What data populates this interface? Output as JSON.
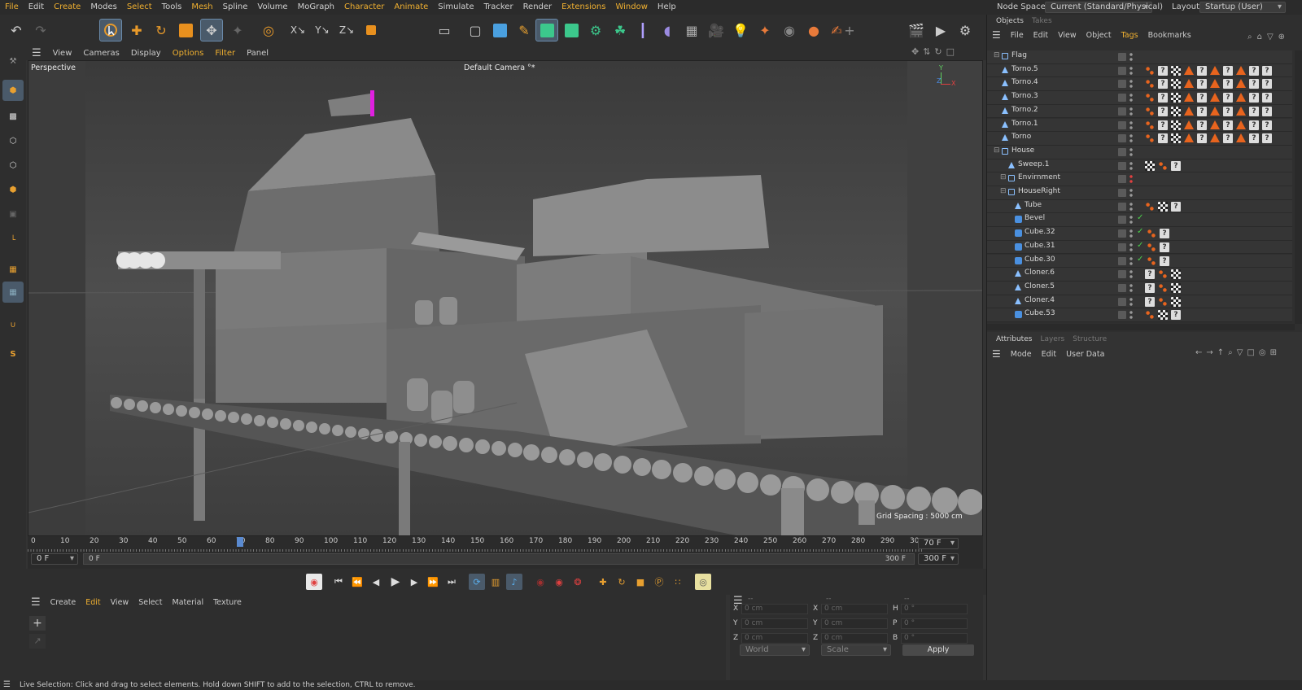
{
  "menubar": {
    "items": [
      "File",
      "Edit",
      "Create",
      "Modes",
      "Select",
      "Tools",
      "Mesh",
      "Spline",
      "Volume",
      "MoGraph",
      "Character",
      "Animate",
      "Simulate",
      "Tracker",
      "Render",
      "Extensions",
      "Window",
      "Help"
    ],
    "highlighted": [
      "Create",
      "Select",
      "Mesh",
      "Character",
      "Animate",
      "Extensions",
      "Window",
      "File"
    ],
    "node_space_label": "Node Space:",
    "node_space_value": "Current (Standard/Physical)",
    "layout_label": "Layout:",
    "layout_value": "Startup (User)"
  },
  "viewport": {
    "menu": [
      "View",
      "Cameras",
      "Display",
      "Options",
      "Filter",
      "Panel"
    ],
    "menu_highlight": [
      "Options",
      "Filter"
    ],
    "perspective_label": "Perspective",
    "camera_label": "Default Camera",
    "camera_mark": "°*",
    "grid_spacing": "Grid Spacing : 5000 cm",
    "axis_y": "Y",
    "axis_z": "Z",
    "axis_x": "X"
  },
  "timeline": {
    "ticks": [
      "0",
      "10",
      "20",
      "30",
      "40",
      "50",
      "60",
      "70",
      "80",
      "90",
      "100",
      "110",
      "120",
      "130",
      "140",
      "150",
      "160",
      "170",
      "180",
      "190",
      "200",
      "210",
      "220",
      "230",
      "240",
      "250",
      "260",
      "270",
      "280",
      "290",
      "30"
    ],
    "current_frame": 70,
    "current_frame_field": "70 F",
    "start_field": "0 F",
    "range_start": "0 F",
    "range_end": "300 F",
    "end_field": "300 F"
  },
  "material_manager": {
    "menu": [
      "Create",
      "Edit",
      "View",
      "Select",
      "Material",
      "Texture"
    ],
    "menu_highlight": [
      "Edit"
    ]
  },
  "coordinates": {
    "headers": [
      "--",
      "--",
      "--"
    ],
    "rows": [
      {
        "a_label": "X",
        "a_value": "0 cm",
        "b_label": "X",
        "b_value": "0 cm",
        "c_label": "H",
        "c_value": "0 °"
      },
      {
        "a_label": "Y",
        "a_value": "0 cm",
        "b_label": "Y",
        "b_value": "0 cm",
        "c_label": "P",
        "c_value": "0 °"
      },
      {
        "a_label": "Z",
        "a_value": "0 cm",
        "b_label": "Z",
        "b_value": "0 cm",
        "c_label": "B",
        "c_value": "0 °"
      }
    ],
    "space_select": "World",
    "mode_select": "Scale",
    "apply_label": "Apply"
  },
  "status_text": "Live Selection: Click and drag to select elements. Hold down SHIFT to add to the selection, CTRL to remove.",
  "objects_panel": {
    "tabs": [
      "Objects",
      "Takes"
    ],
    "menu": [
      "File",
      "Edit",
      "View",
      "Object",
      "Tags",
      "Bookmarks"
    ],
    "menu_highlight": [
      "Tags"
    ],
    "rows": [
      {
        "name": "Flag",
        "indent": 1,
        "icon": "null",
        "tags": "",
        "check": false,
        "red": false
      },
      {
        "name": "Torno.5",
        "indent": 1,
        "icon": "gen",
        "tags": "dqcaqaqaqq",
        "check": false,
        "red": false
      },
      {
        "name": "Torno.4",
        "indent": 1,
        "icon": "gen",
        "tags": "dqcaqaqaqq",
        "check": false,
        "red": false
      },
      {
        "name": "Torno.3",
        "indent": 1,
        "icon": "gen",
        "tags": "dqcaqaqaqq",
        "check": false,
        "red": false
      },
      {
        "name": "Torno.2",
        "indent": 1,
        "icon": "gen",
        "tags": "dqcaqaqaqq",
        "check": false,
        "red": false
      },
      {
        "name": "Torno.1",
        "indent": 1,
        "icon": "gen",
        "tags": "dqcaqaqaqq",
        "check": false,
        "red": false
      },
      {
        "name": "Torno",
        "indent": 1,
        "icon": "gen",
        "tags": "dqcaqaqaqq",
        "check": false,
        "red": false
      },
      {
        "name": "House",
        "indent": 1,
        "icon": "null",
        "tags": "",
        "check": false,
        "red": false
      },
      {
        "name": "Sweep.1",
        "indent": 2,
        "icon": "gen",
        "tags": "cdq",
        "check": false,
        "red": false
      },
      {
        "name": "Envirnment",
        "indent": 2,
        "icon": "null",
        "tags": "",
        "check": false,
        "red": true
      },
      {
        "name": "HouseRight",
        "indent": 2,
        "icon": "null",
        "tags": "",
        "check": false,
        "red": false
      },
      {
        "name": "Tube",
        "indent": 3,
        "icon": "gen",
        "tags": "dcq",
        "check": false,
        "red": false
      },
      {
        "name": "Bevel",
        "indent": 3,
        "icon": "cube",
        "tags": "",
        "check": true,
        "red": false
      },
      {
        "name": "Cube.32",
        "indent": 3,
        "icon": "cube",
        "tags": "dq",
        "check": true,
        "red": false
      },
      {
        "name": "Cube.31",
        "indent": 3,
        "icon": "cube",
        "tags": "dq",
        "check": true,
        "red": false
      },
      {
        "name": "Cube.30",
        "indent": 3,
        "icon": "cube",
        "tags": "dq",
        "check": true,
        "red": false
      },
      {
        "name": "Cloner.6",
        "indent": 3,
        "icon": "gen",
        "tags": "qdc",
        "check": false,
        "red": false
      },
      {
        "name": "Cloner.5",
        "indent": 3,
        "icon": "gen",
        "tags": "qdc",
        "check": false,
        "red": false
      },
      {
        "name": "Cloner.4",
        "indent": 3,
        "icon": "gen",
        "tags": "qdc",
        "check": false,
        "red": false
      },
      {
        "name": "Cube.53",
        "indent": 3,
        "icon": "cube",
        "tags": "dcq",
        "check": false,
        "red": false
      }
    ]
  },
  "attributes_panel": {
    "tabs": [
      "Attributes",
      "Layers",
      "Structure"
    ],
    "menu": [
      "Mode",
      "Edit",
      "User Data"
    ]
  },
  "colors": {
    "accent": "#f0b030",
    "highlight_blue": "#4a5a6a",
    "orange_tag": "#e8641e",
    "playhead": "#5a8ad0"
  }
}
